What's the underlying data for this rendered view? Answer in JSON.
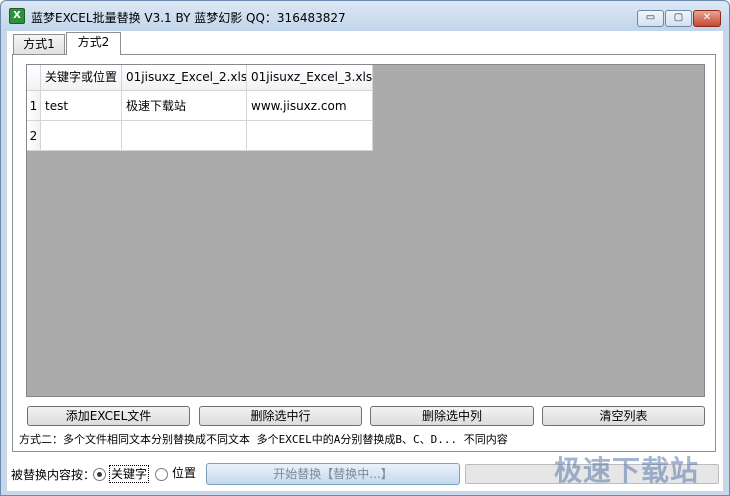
{
  "window": {
    "title": "蓝梦EXCEL批量替换 V3.1 BY 蓝梦幻影 QQ：316483827",
    "app_icon_glyph": "X",
    "min_glyph": "▭",
    "max_glyph": "▢",
    "close_glyph": "✕"
  },
  "tabs": [
    {
      "label": "方式1",
      "selected": false
    },
    {
      "label": "方式2",
      "selected": true
    }
  ],
  "grid": {
    "columns": [
      "关键字或位置",
      "01jisuxz_Excel_2.xls",
      "01jisuxz_Excel_3.xls"
    ],
    "rows": [
      {
        "num": "1",
        "cells": [
          "test",
          "极速下载站",
          "www.jisuxz.com"
        ]
      },
      {
        "num": "2",
        "cells": [
          "",
          "",
          ""
        ]
      }
    ]
  },
  "buttons": {
    "add_excel": "添加EXCEL文件",
    "delete_row": "删除选中行",
    "delete_col": "删除选中列",
    "clear_list": "清空列表"
  },
  "description": "方式二：多个文件相同文本分别替换成不同文本  多个EXCEL中的A分别替换成B、C、D...  不同内容",
  "bottom": {
    "label": "被替换内容按：",
    "radio_keyword": "关键字",
    "radio_position": "位置",
    "keyword_checked": true,
    "start_button": "开始替换【替换中...】",
    "progress_percent": 0
  },
  "watermark": "极速下载站",
  "colors": {
    "titlebar": "#c2d5ea",
    "close_button": "#c44a33",
    "grid_background": "#ababab"
  }
}
